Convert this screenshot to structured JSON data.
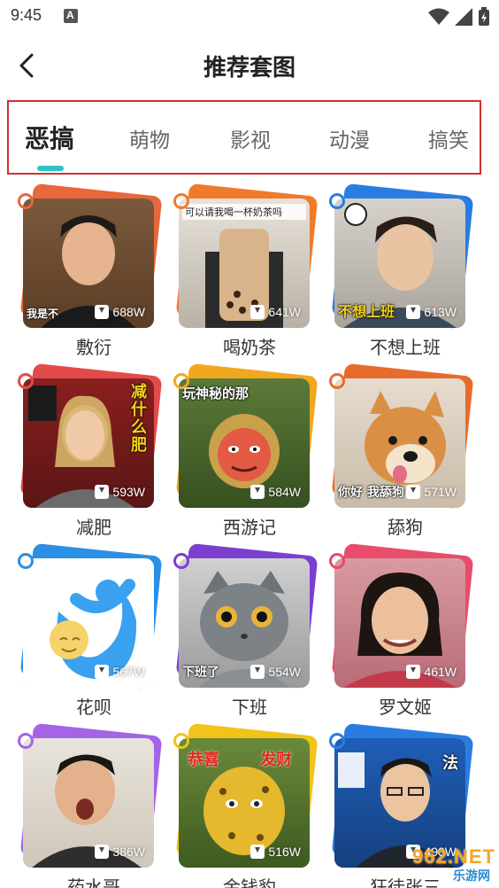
{
  "status_bar": {
    "time": "9:45"
  },
  "header": {
    "title": "推荐套图"
  },
  "tabs": [
    {
      "label": "恶搞",
      "active": true
    },
    {
      "label": "萌物",
      "active": false
    },
    {
      "label": "影视",
      "active": false
    },
    {
      "label": "动漫",
      "active": false
    },
    {
      "label": "搞笑",
      "active": false
    }
  ],
  "colors": {
    "tab_indicator": "#2ec4c4",
    "highlight_box": "#d32f2f"
  },
  "cards": [
    {
      "label": "敷衍",
      "downloads": "688W",
      "accent": "#e8673b",
      "caption": "我是不"
    },
    {
      "label": "喝奶茶",
      "downloads": "641W",
      "accent": "#f07a2c",
      "top_caption": "可以请我喝一杯奶茶吗"
    },
    {
      "label": "不想上班",
      "downloads": "613W",
      "accent": "#2a7de0",
      "caption": "不想上班"
    },
    {
      "label": "减肥",
      "downloads": "593W",
      "accent": "#e34b4b",
      "caption": "减什么肥"
    },
    {
      "label": "西游记",
      "downloads": "584W",
      "accent": "#f2a81e",
      "top_caption": "玩神秘的那"
    },
    {
      "label": "舔狗",
      "downloads": "571W",
      "accent": "#e96b2c",
      "caption": "你好 我舔狗"
    },
    {
      "label": "花呗",
      "downloads": "567W",
      "accent": "#2b8fe6"
    },
    {
      "label": "下班",
      "downloads": "554W",
      "accent": "#7b3fd0",
      "caption": "下班了"
    },
    {
      "label": "罗文姬",
      "downloads": "461W",
      "accent": "#e74c6a"
    },
    {
      "label": "药水哥",
      "downloads": "386W",
      "accent": "#a563e6"
    },
    {
      "label": "金钱豹",
      "downloads": "516W",
      "accent": "#f2c318",
      "caption": "恭喜 发财"
    },
    {
      "label": "狂徒张三",
      "downloads": "490W",
      "accent": "#2a7de0",
      "caption": "法"
    }
  ],
  "watermark": {
    "text": "962.NET",
    "sub": "乐游网"
  }
}
